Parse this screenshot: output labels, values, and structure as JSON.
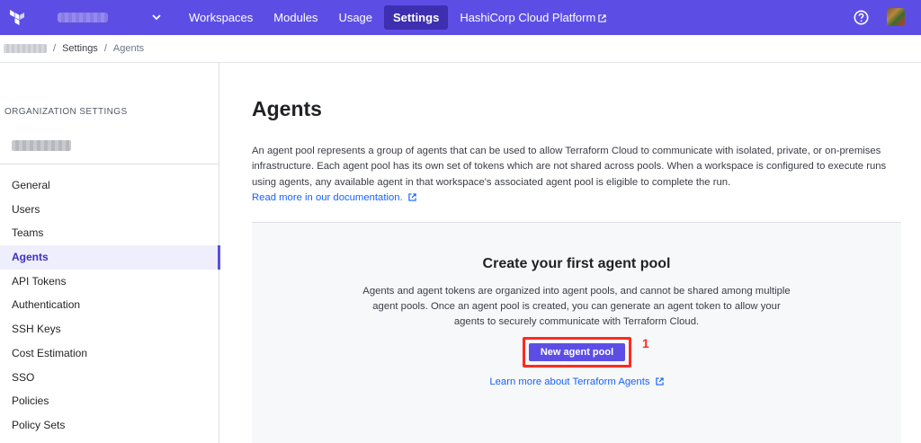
{
  "topnav": {
    "items": [
      {
        "label": "Workspaces"
      },
      {
        "label": "Modules"
      },
      {
        "label": "Usage"
      },
      {
        "label": "Settings"
      },
      {
        "label": "HashiCorp Cloud Platform"
      }
    ],
    "active": "Settings",
    "icons": [
      "terraform-logo",
      "chevron-down-icon",
      "external-link-icon",
      "help-icon",
      "user-avatar"
    ],
    "colors": {
      "bar": "#5c4ee5",
      "active": "#3d2fb0"
    }
  },
  "breadcrumb": {
    "items": [
      "Settings",
      "Agents"
    ]
  },
  "sidebar": {
    "heading": "ORGANIZATION SETTINGS",
    "items": [
      {
        "label": "General"
      },
      {
        "label": "Users"
      },
      {
        "label": "Teams"
      },
      {
        "label": "Agents"
      },
      {
        "label": "API Tokens"
      },
      {
        "label": "Authentication"
      },
      {
        "label": "SSH Keys"
      },
      {
        "label": "Cost Estimation"
      },
      {
        "label": "SSO"
      },
      {
        "label": "Policies"
      },
      {
        "label": "Policy Sets"
      }
    ],
    "active": "Agents"
  },
  "main": {
    "title": "Agents",
    "description": "An agent pool represents a group of agents that can be used to allow Terraform Cloud to communicate with isolated, private, or on-premises infrastructure. Each agent pool has its own set of tokens which are not shared across pools. When a workspace is configured to execute runs using agents, any available agent in that workspace's associated agent pool is eligible to complete the run.",
    "doc_link": "Read more in our documentation.",
    "empty_state": {
      "title": "Create your first agent pool",
      "text": "Agents and agent tokens are organized into agent pools, and cannot be shared among multiple agent pools. Once an agent pool is created, you can generate an agent token to allow your agents to securely communicate with Terraform Cloud.",
      "button": "New agent pool",
      "marker": "1",
      "learn_link": "Learn more about Terraform Agents"
    },
    "colors": {
      "link": "#1563ff",
      "button": "#5c4ee5",
      "highlight": "#ff2a1f"
    }
  }
}
